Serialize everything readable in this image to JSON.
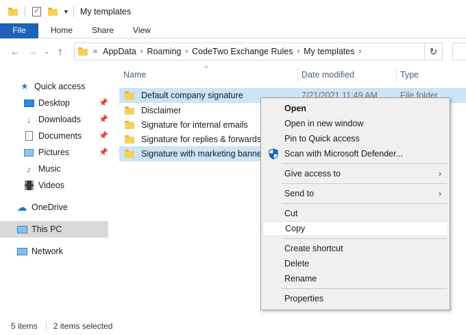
{
  "window": {
    "title": "My templates"
  },
  "ribbon": {
    "tabs": [
      "File",
      "Home",
      "Share",
      "View"
    ]
  },
  "address": {
    "lead": "«",
    "crumbs": [
      "AppData",
      "Roaming",
      "CodeTwo Exchange Rules",
      "My templates"
    ],
    "refresh_icon": "refresh-icon"
  },
  "navpane": {
    "items": [
      {
        "label": "Quick access",
        "icon": "star-icon",
        "pinned": false
      },
      {
        "label": "Desktop",
        "icon": "desktop-icon",
        "pinned": true
      },
      {
        "label": "Downloads",
        "icon": "download-arrow-icon",
        "pinned": true
      },
      {
        "label": "Documents",
        "icon": "document-icon",
        "pinned": true
      },
      {
        "label": "Pictures",
        "icon": "pictures-icon",
        "pinned": true
      },
      {
        "label": "Music",
        "icon": "music-note-icon",
        "pinned": false
      },
      {
        "label": "Videos",
        "icon": "videos-icon",
        "pinned": false
      },
      {
        "label": "OneDrive",
        "icon": "cloud-icon",
        "pinned": false
      },
      {
        "label": "This PC",
        "icon": "monitor-icon",
        "pinned": false,
        "selected": true
      },
      {
        "label": "Network",
        "icon": "network-icon",
        "pinned": false
      }
    ]
  },
  "columns": {
    "name": "Name",
    "date": "Date modified",
    "type": "Type"
  },
  "files": [
    {
      "name": "Default company signature",
      "date": "7/21/2021 11:49 AM",
      "type": "File folder",
      "selected": true
    },
    {
      "name": "Disclaimer",
      "date": "",
      "type": "",
      "selected": false
    },
    {
      "name": "Signature for internal emails",
      "date": "",
      "type": "",
      "selected": false
    },
    {
      "name": "Signature for replies & forwards",
      "date": "",
      "type": "",
      "selected": false
    },
    {
      "name": "Signature with marketing banner",
      "date": "",
      "type": "",
      "selected": true
    }
  ],
  "status": {
    "count": "5 items",
    "selected": "2 items selected"
  },
  "context_menu": {
    "items": [
      {
        "label": "Open",
        "bold": true
      },
      {
        "label": "Open in new window"
      },
      {
        "label": "Pin to Quick access"
      },
      {
        "label": "Scan with Microsoft Defender...",
        "icon": "defender-shield-icon"
      },
      {
        "label": "Give access to",
        "submenu": true
      },
      {
        "label": "Send to",
        "submenu": true
      },
      {
        "label": "Cut"
      },
      {
        "label": "Copy",
        "hover": true
      },
      {
        "label": "Create shortcut"
      },
      {
        "label": "Delete"
      },
      {
        "label": "Rename"
      },
      {
        "label": "Properties"
      }
    ]
  },
  "colors": {
    "file_tab": "#1b62b8",
    "selection": "#cce4f7",
    "folder": "#f7cf5b",
    "menu_bg": "#f0f0f0"
  }
}
